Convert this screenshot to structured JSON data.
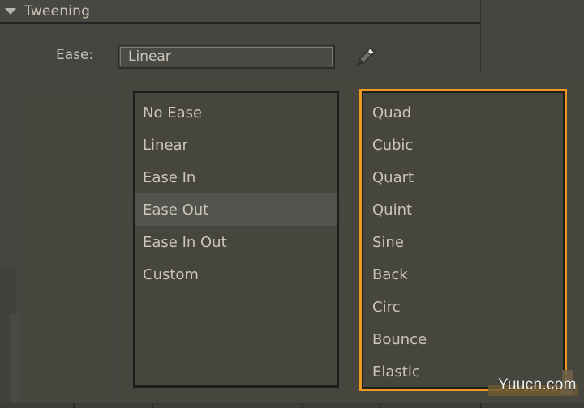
{
  "section": {
    "title": "Tweening",
    "collapse_icon": "triangle-down-icon",
    "expanded": true
  },
  "ease_row": {
    "label": "Ease:",
    "field_value": "Linear",
    "field_placeholder": "Linear",
    "edit_icon": "pencil-icon"
  },
  "dropdown": {
    "ease_type_list": {
      "name": "ease-type-list",
      "selected": "Ease Out",
      "items": [
        {
          "label": "No Ease",
          "selected": false
        },
        {
          "label": "Linear",
          "selected": false
        },
        {
          "label": "Ease In",
          "selected": false
        },
        {
          "label": "Ease Out",
          "selected": true
        },
        {
          "label": "Ease In Out",
          "selected": false
        },
        {
          "label": "Custom",
          "selected": false
        }
      ]
    },
    "ease_curve_list": {
      "name": "ease-curve-list",
      "focused": true,
      "focus_border_color": "#f0991e",
      "selected": "",
      "items": [
        {
          "label": "Quad",
          "selected": false
        },
        {
          "label": "Cubic",
          "selected": false
        },
        {
          "label": "Quart",
          "selected": false
        },
        {
          "label": "Quint",
          "selected": false
        },
        {
          "label": "Sine",
          "selected": false
        },
        {
          "label": "Back",
          "selected": false
        },
        {
          "label": "Circ",
          "selected": false
        },
        {
          "label": "Bounce",
          "selected": false
        },
        {
          "label": "Elastic",
          "selected": false
        }
      ]
    }
  },
  "watermark": {
    "text": "Yuucn.com"
  },
  "colors": {
    "panel_bg": "#444441",
    "list_bg": "#46463f",
    "header_bg": "#474743",
    "text": "#cbc5b8",
    "selected_row": "#54544e",
    "accent_focus": "#f0991e",
    "border_dark": "#1d1d1d"
  }
}
